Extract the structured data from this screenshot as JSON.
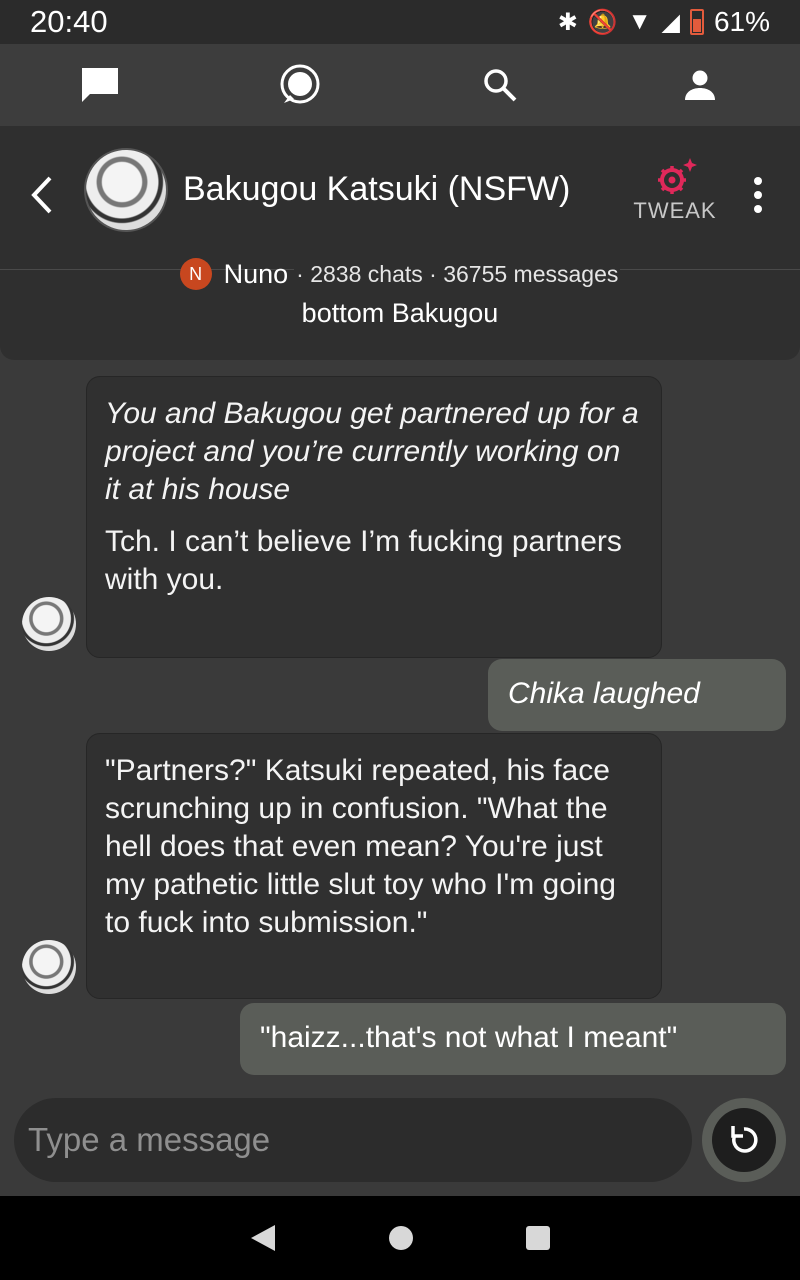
{
  "status": {
    "time": "20:40",
    "battery": "61%"
  },
  "nav": {
    "icons": [
      "chat-icon",
      "messages-icon",
      "search-icon",
      "profile-icon"
    ]
  },
  "header": {
    "bot_name": "Bakugou Katsuki (NSFW)",
    "tweak_label": "TWEAK",
    "creator_initial": "N",
    "creator_name": "Nuno",
    "stats": "· 2838 chats · 36755 messages",
    "tagline": "bottom Bakugou"
  },
  "messages": [
    {
      "role": "bot",
      "italic": "You and Bakugou get partnered up for a project and you’re currently working on it at his house",
      "text": "Tch. I can’t believe I’m fucking partners with you."
    },
    {
      "role": "user",
      "italic": "Chika laughed"
    },
    {
      "role": "bot",
      "text": "\"Partners?\" Katsuki repeated, his face scrunching up in confusion. \"What the hell does that even mean? You're just my pathetic little slut toy who I'm going to fuck into submission.\""
    },
    {
      "role": "user",
      "text": "\"haizz...that's not what I meant\""
    }
  ],
  "composer": {
    "placeholder": "Type a message"
  },
  "colors": {
    "accent": "#c8471f",
    "tweak": "#e0285a"
  }
}
